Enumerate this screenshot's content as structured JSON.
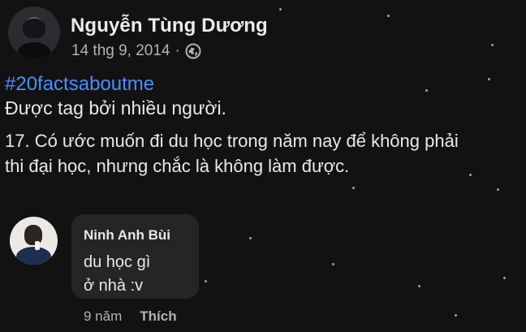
{
  "post": {
    "author_name": "Nguyễn Tùng Dương",
    "date": "14 thg 9, 2014",
    "separator": "·",
    "visibility_icon": "globe-icon",
    "more_icon": "more-icon",
    "hashtag": "#20factsaboutme",
    "tagged_text": "Được tag bởi nhiều người.",
    "body_text": "17. Có ước muốn đi du học trong năm nay để không phải\nthi đại học, nhưng chắc là không làm được."
  },
  "comment": {
    "name": "Ninh Anh Bùi",
    "lines": [
      "du học gì",
      "ở nhà :v"
    ],
    "time": "9 năm",
    "like_label": "Thích"
  },
  "colors": {
    "background": "#121213",
    "bubble": "#242526",
    "primary_text": "#e4e6eb",
    "secondary_text": "#b0b3b8",
    "hashtag": "#4b8dff"
  }
}
